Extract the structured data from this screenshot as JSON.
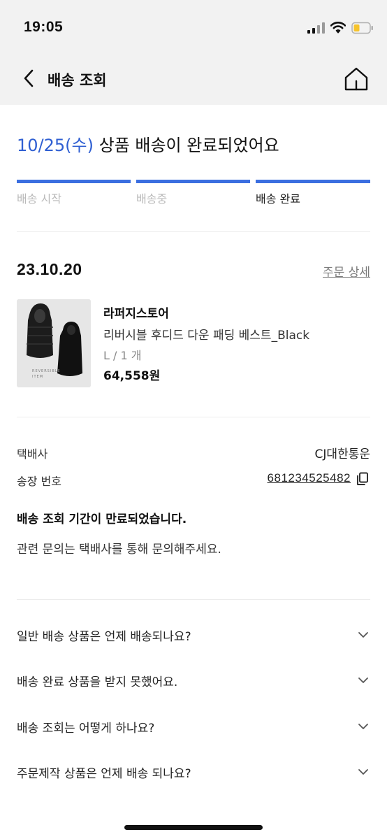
{
  "status_bar": {
    "time": "19:05"
  },
  "nav": {
    "title": "배송 조회",
    "back_icon": "chevron-left-icon",
    "home_icon": "home-icon"
  },
  "headline": {
    "date": "10/25(수)",
    "message": " 상품 배송이 완료되었어요"
  },
  "progress": {
    "steps": [
      {
        "label": "배송 시작",
        "active": false
      },
      {
        "label": "배송중",
        "active": false
      },
      {
        "label": "배송 완료",
        "active": true
      }
    ],
    "completed_fraction": 1.0,
    "color": "#3b6ee0"
  },
  "order": {
    "date": "23.10.20",
    "detail_link": "주문 상세"
  },
  "product": {
    "brand": "라퍼지스토어",
    "name": "리버시블 후디드 다운 패딩 베스트_Black",
    "option": "L / 1 개",
    "price": "64,558원",
    "image_text": "REVERSIBLE ITEM"
  },
  "shipping": {
    "carrier_label": "택배사",
    "carrier_value": "CJ대한통운",
    "tracking_label": "송장 번호",
    "tracking_value": "681234525482"
  },
  "notice": {
    "title": "배송 조회 기간이 만료되었습니다.",
    "text": "관련 문의는 택배사를 통해 문의해주세요."
  },
  "faq": [
    {
      "question": "일반 배송 상품은 언제 배송되나요?"
    },
    {
      "question": "배송 완료 상품을 받지 못했어요."
    },
    {
      "question": "배송 조회는 어떻게 하나요?"
    },
    {
      "question": "주문제작 상품은 언제 배송 되나요?"
    }
  ],
  "colors": {
    "accent": "#2f5fd2",
    "header_bg": "#f2f2f2",
    "battery": "#f6c32b"
  }
}
